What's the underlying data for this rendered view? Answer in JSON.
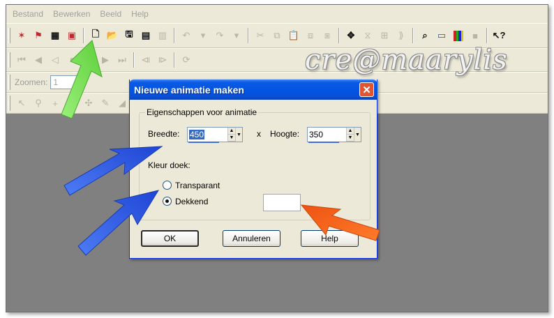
{
  "menubar": {
    "items": [
      "Bestand",
      "Bewerken",
      "Beeld",
      "Help"
    ]
  },
  "toolbar": {
    "zoom_label": "Zoomen:",
    "zoom_value": "1"
  },
  "watermark": "cre@maarylis",
  "dialog": {
    "title": "Nieuwe animatie maken",
    "close_glyph": "✕",
    "group_label": "Eigenschappen voor animatie",
    "width_label": "Breedte:",
    "width_value": "450",
    "times_symbol": "x",
    "height_label": "Hoogte:",
    "height_value": "350",
    "canvas_color_label": "Kleur doek:",
    "radio_transparent": "Transparant",
    "radio_opaque": "Dekkend",
    "selected_option": "Dekkend",
    "swatch_color": "#ffffff",
    "buttons": {
      "ok": "OK",
      "cancel": "Annuleren",
      "help": "Help"
    }
  },
  "annotations": {
    "arrow_colors": {
      "green": "#7de35a",
      "blue": "#2f5be8",
      "orange": "#f4661f"
    }
  },
  "colors": {
    "workspace": "#808080",
    "chrome": "#ece9d8",
    "titlebar": "#0255e2"
  }
}
